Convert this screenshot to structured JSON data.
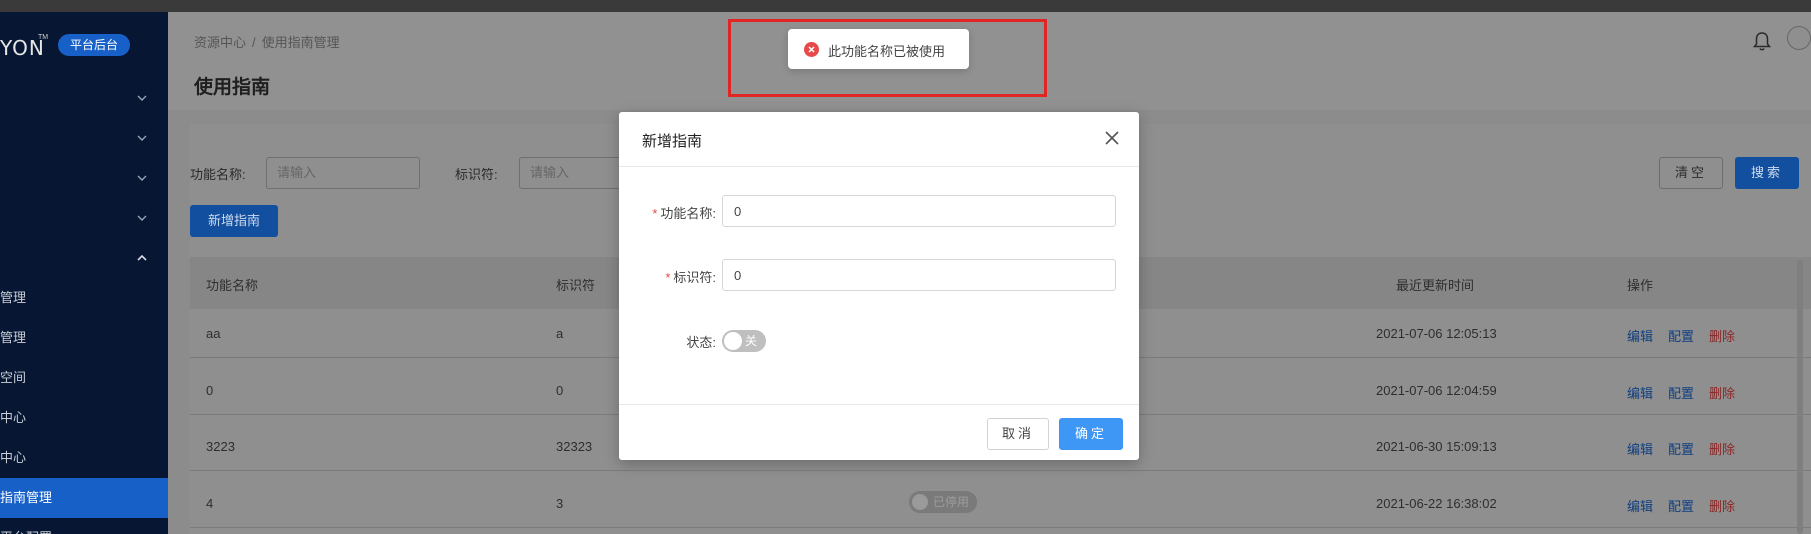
{
  "sidebar": {
    "logo": "YON",
    "logo_tm": "TM",
    "platform_badge": "平台后台",
    "sub_items": [
      "管理",
      "管理",
      "空间",
      "中心",
      "中心",
      "指南管理",
      "平台配置"
    ]
  },
  "header": {
    "breadcrumb": [
      "资源中心",
      "使用指南管理"
    ],
    "breadcrumb_sep": "/",
    "title": "使用指南"
  },
  "filters": {
    "name_label": "功能名称:",
    "name_placeholder": "请输入",
    "id_label": "标识符:",
    "id_placeholder": "请输入",
    "clear_label": "清空",
    "search_label": "搜索",
    "add_label": "新增指南"
  },
  "table": {
    "columns": [
      "功能名称",
      "标识符",
      "最近更新时间",
      "操作"
    ],
    "rows": [
      {
        "name": "aa",
        "id": "a",
        "updated": "2021-07-06 12:05:13"
      },
      {
        "name": "0",
        "id": "0",
        "updated": "2021-07-06 12:04:59"
      },
      {
        "name": "3223",
        "id": "32323",
        "updated": "2021-06-30 15:09:13"
      },
      {
        "name": "4",
        "id": "3",
        "status": "已停用",
        "updated": "2021-06-22 16:38:02"
      }
    ],
    "actions": {
      "edit": "编辑",
      "config": "配置",
      "delete": "删除"
    }
  },
  "modal": {
    "title": "新增指南",
    "fields": {
      "name_label": "功能名称:",
      "name_value": "0",
      "id_label": "标识符:",
      "id_value": "0",
      "status_label": "状态:",
      "status_toggle": "关"
    },
    "required_mark": "*",
    "cancel_label": "取消",
    "ok_label": "确定"
  },
  "toast": {
    "message": "此功能名称已被使用",
    "type": "error",
    "icon": "error-circle-icon"
  },
  "colors": {
    "sidebar_bg": "#071633",
    "primary": "#3e97f5",
    "error": "#e64a4a",
    "annotation": "#e02525"
  }
}
